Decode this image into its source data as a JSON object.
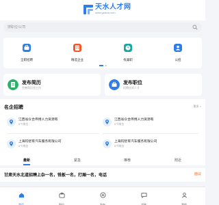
{
  "header": {
    "logo_title": "天水人才网",
    "logo_sub": "www.gstrcw.com"
  },
  "search": {
    "placeholder": "搜职位/公司"
  },
  "nav": {
    "items": [
      {
        "label": "全职招聘",
        "icon": "briefcase-icon",
        "color": "#2f7ee8"
      },
      {
        "label": "精选企业",
        "icon": "building-icon",
        "color": "#f0572a"
      },
      {
        "label": "找兼职",
        "icon": "clock-icon",
        "color": "#1aa5a5"
      },
      {
        "label": "公招",
        "icon": "people-icon",
        "color": "#2f7ee8"
      }
    ]
  },
  "actions": [
    {
      "title": "发布简历",
      "subtitle": "完善简历找工作",
      "icon": "resume-icon",
      "color": "#2db16a"
    },
    {
      "title": "发布职位",
      "subtitle": "招聘优质人才",
      "icon": "post-job-icon",
      "color": "#2f7ee8"
    }
  ],
  "companies": {
    "title": "名企招聘",
    "more": "更多 >",
    "items": [
      {
        "name": "江西省众合伟博人力资源有",
        "jobs": "0个岗位"
      },
      {
        "name": "江西省众合伟博人力资源有",
        "jobs": "0个岗位"
      },
      {
        "name": "上海钧智育汽车服务有限公司",
        "jobs": "0个岗位"
      },
      {
        "name": "上海钧智育汽车服务有限公司",
        "jobs": "0个岗位"
      }
    ]
  },
  "tabs": [
    "最新",
    "紧急",
    "推荐",
    "附近"
  ],
  "news": {
    "title": "甘肃天水北道招聘上杂一名，铣板一名，打厢一名，电话",
    "tag": "面议"
  },
  "tabbar": [
    "首页",
    "职位",
    "发布",
    "消息",
    "我的"
  ]
}
